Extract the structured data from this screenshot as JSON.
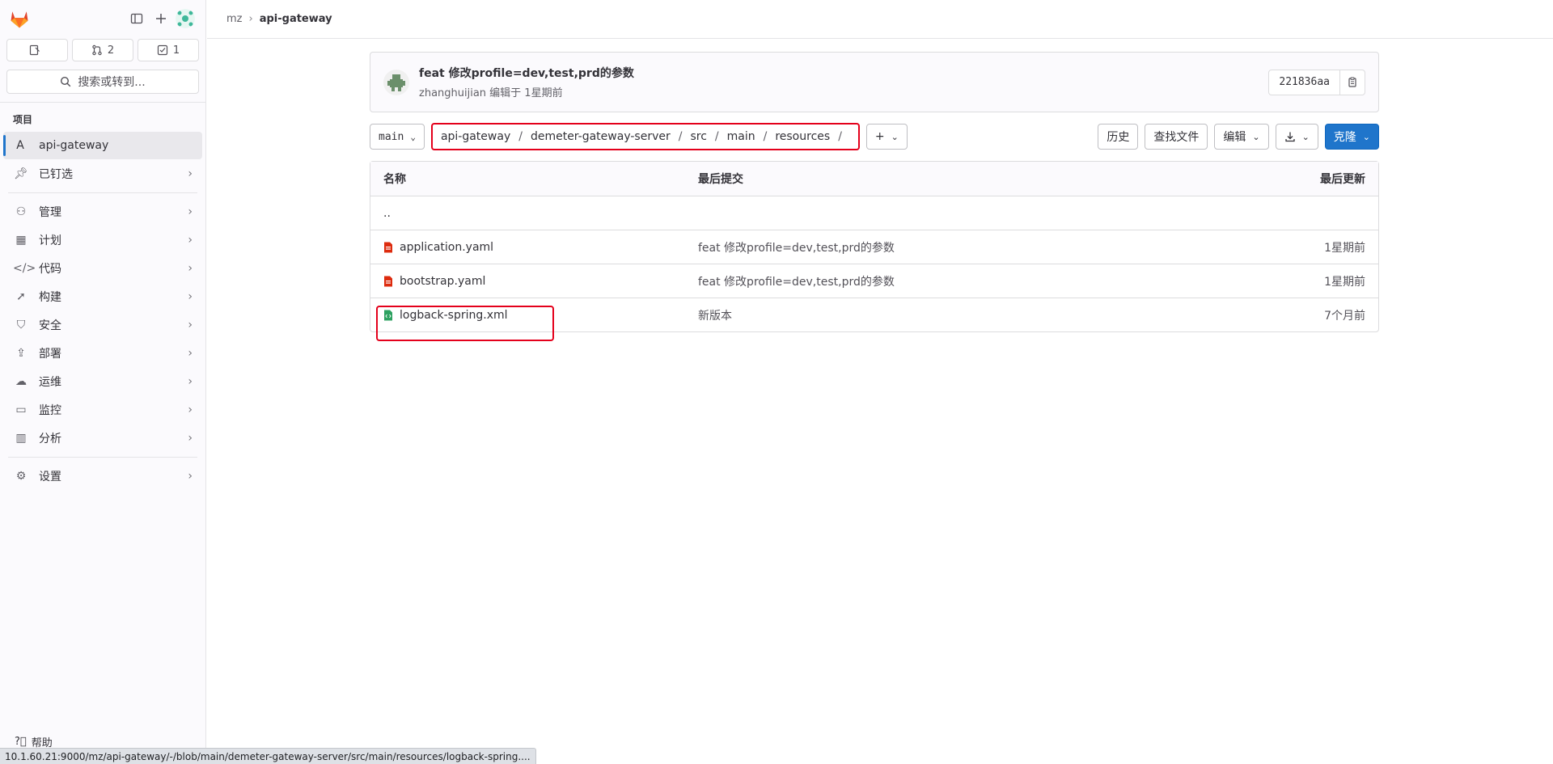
{
  "sidebar": {
    "counts": [
      {
        "icon": "issues-icon",
        "value": ""
      },
      {
        "icon": "merge-request-icon",
        "value": "2"
      },
      {
        "icon": "todo-icon",
        "value": "1"
      }
    ],
    "search_label": "搜索或转到...",
    "section_label": "项目",
    "project": {
      "letter": "A",
      "name": "api-gateway"
    },
    "items": [
      {
        "label": "已钉选",
        "icon": "pin-icon"
      },
      {
        "label": "管理",
        "icon": "manage-icon"
      },
      {
        "label": "计划",
        "icon": "plan-icon"
      },
      {
        "label": "代码",
        "icon": "code-icon"
      },
      {
        "label": "构建",
        "icon": "rocket-icon"
      },
      {
        "label": "安全",
        "icon": "shield-icon"
      },
      {
        "label": "部署",
        "icon": "deploy-icon"
      },
      {
        "label": "运维",
        "icon": "cloud-icon"
      },
      {
        "label": "监控",
        "icon": "monitor-icon"
      },
      {
        "label": "分析",
        "icon": "chart-icon"
      },
      {
        "label": "设置",
        "icon": "gear-icon"
      }
    ],
    "help_label": "帮助"
  },
  "breadcrumb": {
    "parent": "mz",
    "current": "api-gateway"
  },
  "commit": {
    "title": "feat 修改profile=dev,test,prd的参数",
    "meta": "zhanghuijian 编辑于 1星期前",
    "sha": "221836aa"
  },
  "toolbar": {
    "branch": "main",
    "path": [
      "api-gateway",
      "demeter-gateway-server",
      "src",
      "main",
      "resources"
    ],
    "history": "历史",
    "find_file": "查找文件",
    "edit": "编辑",
    "clone": "克隆"
  },
  "table": {
    "headers": {
      "name": "名称",
      "last_commit": "最后提交",
      "last_update": "最后更新"
    },
    "parent_dir": "..",
    "rows": [
      {
        "name": "application.yaml",
        "commit": "feat 修改profile=dev,test,prd的参数",
        "updated": "1星期前",
        "icon_color": "#dd2b0e"
      },
      {
        "name": "bootstrap.yaml",
        "commit": "feat 修改profile=dev,test,prd的参数",
        "updated": "1星期前",
        "icon_color": "#dd2b0e"
      },
      {
        "name": "logback-spring.xml",
        "commit": "新版本",
        "updated": "7个月前",
        "icon_color": "#2da160"
      }
    ]
  },
  "status_url": "10.1.60.21:9000/mz/api-gateway/-/blob/main/demeter-gateway-server/src/main/resources/logback-spring...."
}
